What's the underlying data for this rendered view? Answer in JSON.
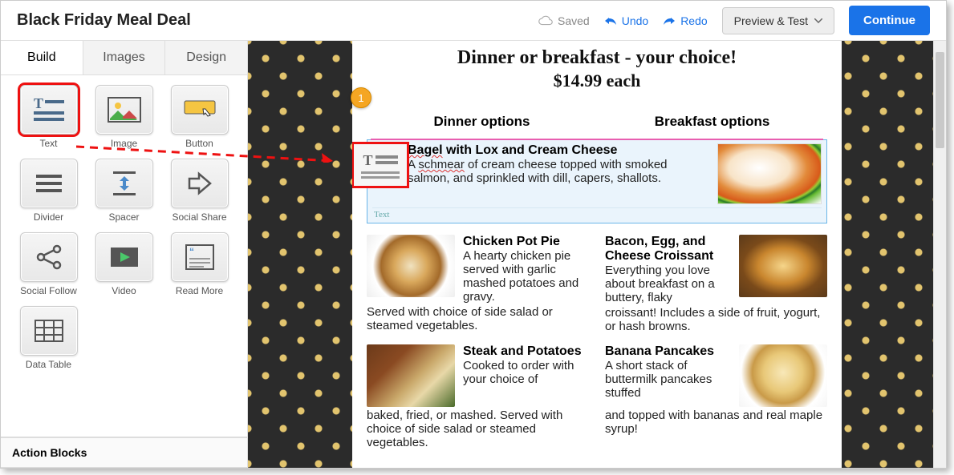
{
  "header": {
    "title": "Black Friday Meal Deal",
    "saved": "Saved",
    "undo": "Undo",
    "redo": "Redo",
    "preview": "Preview & Test",
    "continue": "Continue"
  },
  "sidebar": {
    "tabs": {
      "build": "Build",
      "images": "Images",
      "design": "Design"
    },
    "blocks": {
      "text": "Text",
      "image": "Image",
      "button": "Button",
      "divider": "Divider",
      "spacer": "Spacer",
      "social_share": "Social Share",
      "social_follow": "Social Follow",
      "video": "Video",
      "read_more": "Read More",
      "data_table": "Data Table"
    },
    "action_blocks": "Action Blocks"
  },
  "canvas": {
    "title": "Dinner or breakfast - your choice!",
    "price": "$14.99 each",
    "col1": "Dinner options",
    "col2": "Breakfast options",
    "drop": {
      "title": "Bagel with Lox and Cream Cheese",
      "title_prefix": "Bagel",
      "title_rest": " with Lox and Cream Cheese",
      "desc_prefix": "A ",
      "desc_word": "schmear",
      "desc_rest": " of cream cheese topped with smoked salmon, and sprinkled with dill, capers, shallots.",
      "label": "Text"
    },
    "items": {
      "potpie": {
        "title": "Chicken Pot Pie",
        "desc": "A hearty chicken pie served with garlic mashed potatoes and gravy.",
        "cont": "Served with choice of side salad or steamed vegetables."
      },
      "croissant": {
        "title": "Bacon, Egg, and Cheese Croissant",
        "desc": "Everything you love about breakfast on a buttery, flaky",
        "cont": "croissant! Includes a side of fruit, yogurt, or hash browns."
      },
      "steak": {
        "title": "Steak and Potatoes",
        "desc": "Cooked to order with your choice of",
        "cont": "baked, fried, or mashed. Served with choice of side salad or steamed vegetables."
      },
      "pancake": {
        "title": "Banana Pancakes",
        "desc": "A short stack of buttermilk pancakes stuffed",
        "cont": "and topped with bananas and real maple syrup!"
      }
    }
  },
  "annotation": {
    "step": "1"
  }
}
